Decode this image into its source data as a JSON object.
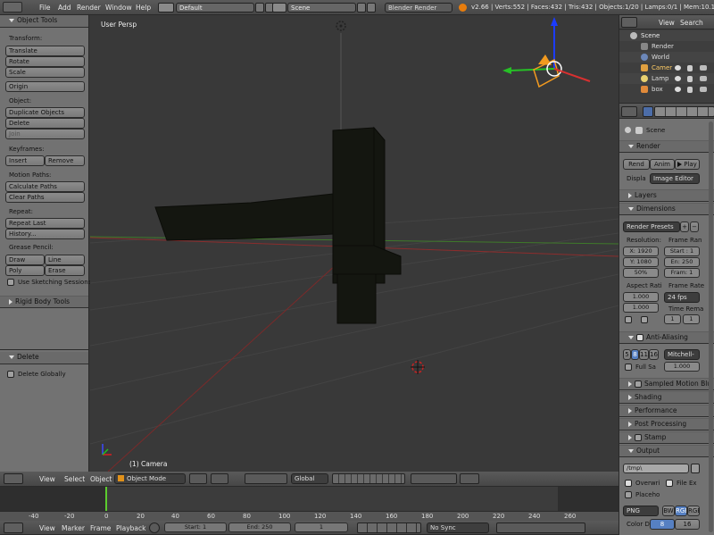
{
  "top_bar": {
    "menus": [
      "File",
      "Add",
      "Render",
      "Window",
      "Help"
    ],
    "layout_name": "Default",
    "scene_name": "Scene",
    "render_engine": "Blender Render",
    "stats": "v2.66 | Verts:552 | Faces:432 | Tris:432 | Objects:1/20 | Lamps:0/1 | Mem:10.12M (0"
  },
  "tool_shelf": {
    "title": "Object Tools",
    "transform_label": "Transform:",
    "translate": "Translate",
    "rotate": "Rotate",
    "scale": "Scale",
    "origin": "Origin",
    "object_label": "Object:",
    "duplicate": "Duplicate Objects",
    "delete": "Delete",
    "join": "Join",
    "keyframes_label": "Keyframes:",
    "insert": "Insert",
    "remove": "Remove",
    "motion_paths_label": "Motion Paths:",
    "calc_paths": "Calculate Paths",
    "clear_paths": "Clear Paths",
    "repeat_label": "Repeat:",
    "repeat_last": "Repeat Last",
    "history": "History...",
    "grease_label": "Grease Pencil:",
    "draw": "Draw",
    "line": "Line",
    "poly": "Poly",
    "erase": "Erase",
    "sketching": "Use Sketching Sessions",
    "rigid_body": "Rigid Body Tools",
    "operator_title": "Delete",
    "delete_globally": "Delete Globally"
  },
  "viewport": {
    "view_name": "User Persp",
    "object_label": "(1) Camera"
  },
  "viewport_header": {
    "menus": [
      "View",
      "Select",
      "Object"
    ],
    "mode": "Object Mode",
    "orientation": "Global"
  },
  "outliner": {
    "view": "View",
    "search": "Search",
    "items": [
      "Scene",
      "Render",
      "World",
      "Camer",
      "Lamp",
      "box"
    ]
  },
  "properties": {
    "context": "Scene",
    "render_panel": "Render",
    "render_btn": "Rend",
    "anim_btn": "Anim",
    "play_btn": "Play",
    "display_label": "Displa",
    "display_value": "Image Editor",
    "layers_panel": "Layers",
    "dimensions_panel": "Dimensions",
    "render_presets": "Render Presets",
    "resolution_label": "Resolution:",
    "frame_range_label": "Frame Ran",
    "res_x": "X: 1920",
    "res_y": "Y: 1080",
    "res_pct": "50%",
    "start": "Start : 1",
    "end": "En: 250",
    "frame_step": "Fram: 1",
    "aspect_label": "Aspect Rati",
    "frame_rate_label": "Frame Rate",
    "aspect_x": "1.000",
    "aspect_y": "1.000",
    "fps": "24 fps",
    "time_remap_label": "Time Rema",
    "remap_old": "1",
    "remap_new": "1",
    "aa_panel": "Anti-Aliasing",
    "aa_samples": [
      "5",
      "8",
      "11",
      "16"
    ],
    "aa_filter": "Mitchell-",
    "full_sample": "Full Sa",
    "aa_size": "1.000",
    "motion_blur": "Sampled Motion Blu",
    "shading": "Shading",
    "performance": "Performance",
    "post_processing": "Post Processing",
    "stamp": "Stamp",
    "output_panel": "Output",
    "output_path": "/tmp\\",
    "overwrite": "Overwri",
    "file_ext": "File Ex",
    "placeholders": "Placeho",
    "format": "PNG",
    "color_modes": [
      "BW",
      "RGB",
      "RGB"
    ],
    "color_depth_label": "Color D",
    "color_depth": [
      "8",
      "16"
    ]
  },
  "timeline": {
    "ticks": [
      "-40",
      "-20",
      "0",
      "20",
      "40",
      "60",
      "80",
      "100",
      "120",
      "140",
      "160",
      "180",
      "200",
      "220",
      "240",
      "260"
    ],
    "menus": [
      "View",
      "Marker",
      "Frame",
      "Playback"
    ],
    "start": "Start: 1",
    "end": "End: 250",
    "current": "1",
    "sync": "No Sync"
  }
}
